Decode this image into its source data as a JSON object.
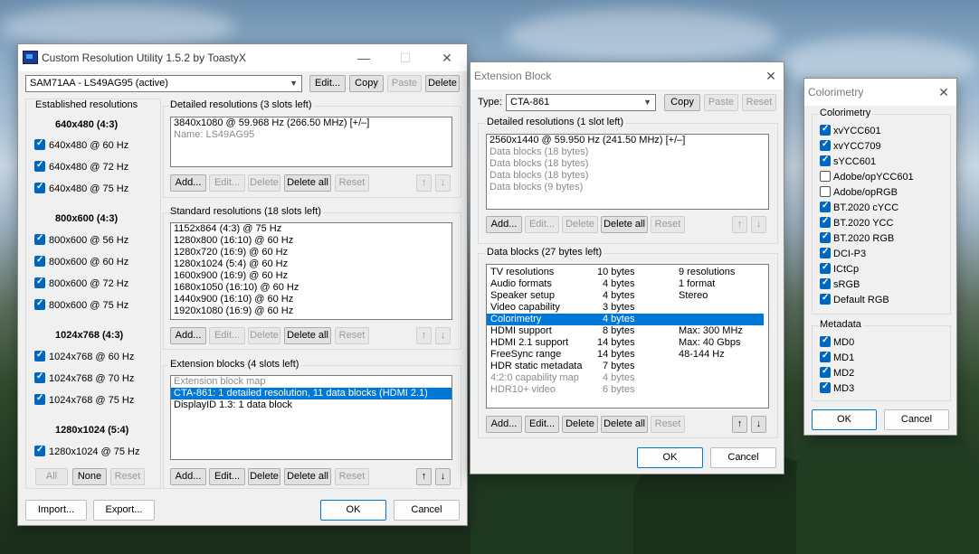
{
  "cru": {
    "title": "Custom Resolution Utility 1.5.2 by ToastyX",
    "monitor": "SAM71AA - LS49AG95 (active)",
    "top_buttons": {
      "edit": "Edit...",
      "copy": "Copy",
      "paste": "Paste",
      "delete": "Delete"
    },
    "established": {
      "title": "Established resolutions",
      "groups": [
        {
          "header": "640x480 (4:3)",
          "items": [
            "640x480 @ 60 Hz",
            "640x480 @ 72 Hz",
            "640x480 @ 75 Hz"
          ]
        },
        {
          "header": "800x600 (4:3)",
          "items": [
            "800x600 @ 56 Hz",
            "800x600 @ 60 Hz",
            "800x600 @ 72 Hz",
            "800x600 @ 75 Hz"
          ]
        },
        {
          "header": "1024x768 (4:3)",
          "items": [
            "1024x768 @ 60 Hz",
            "1024x768 @ 70 Hz",
            "1024x768 @ 75 Hz"
          ]
        },
        {
          "header": "1280x1024 (5:4)",
          "items": [
            "1280x1024 @ 75 Hz"
          ]
        }
      ],
      "all": "All",
      "none": "None",
      "reset": "Reset"
    },
    "detailed": {
      "title": "Detailed resolutions (3 slots left)",
      "items": [
        "3840x1080 @ 59.968 Hz (266.50 MHz) [+/–]",
        "Name: LS49AG95"
      ]
    },
    "standard": {
      "title": "Standard resolutions (18 slots left)",
      "items": [
        "1152x864 (4:3) @ 75 Hz",
        "1280x800 (16:10) @ 60 Hz",
        "1280x720 (16:9) @ 60 Hz",
        "1280x1024 (5:4) @ 60 Hz",
        "1600x900 (16:9) @ 60 Hz",
        "1680x1050 (16:10) @ 60 Hz",
        "1440x900 (16:10) @ 60 Hz",
        "1920x1080 (16:9) @ 60 Hz"
      ]
    },
    "extension": {
      "title": "Extension blocks (4 slots left)",
      "items": [
        "Extension block map",
        "CTA-861: 1 detailed resolution, 11 data blocks (HDMI 2.1)",
        "DisplayID 1.3: 1 data block"
      ]
    },
    "list_buttons": {
      "add": "Add...",
      "edit": "Edit...",
      "delete": "Delete",
      "delete_all": "Delete all",
      "reset": "Reset"
    },
    "bottom": {
      "import": "Import...",
      "export": "Export...",
      "ok": "OK",
      "cancel": "Cancel"
    }
  },
  "ext": {
    "title": "Extension Block",
    "type_label": "Type:",
    "type_value": "CTA-861",
    "copy": "Copy",
    "paste": "Paste",
    "reset": "Reset",
    "detailed": {
      "title": "Detailed resolutions (1 slot left)",
      "items": [
        "2560x1440 @ 59.950 Hz (241.50 MHz) [+/–]",
        "Data blocks (18 bytes)",
        "Data blocks (18 bytes)",
        "Data blocks (18 bytes)",
        "Data blocks (9 bytes)"
      ]
    },
    "data": {
      "title": "Data blocks (27 bytes left)",
      "rows": [
        [
          "TV resolutions",
          "10 bytes",
          "9 resolutions"
        ],
        [
          "Audio formats",
          "4 bytes",
          "1 format"
        ],
        [
          "Speaker setup",
          "4 bytes",
          "Stereo"
        ],
        [
          "Video capability",
          "3 bytes",
          ""
        ],
        [
          "Colorimetry",
          "4 bytes",
          ""
        ],
        [
          "HDMI support",
          "8 bytes",
          "Max: 300 MHz"
        ],
        [
          "HDMI 2.1 support",
          "14 bytes",
          "Max: 40 Gbps"
        ],
        [
          "FreeSync range",
          "14 bytes",
          "48-144 Hz"
        ],
        [
          "HDR static metadata",
          "7 bytes",
          ""
        ],
        [
          "4:2:0 capability map",
          "4 bytes",
          ""
        ],
        [
          "HDR10+ video",
          "6 bytes",
          ""
        ]
      ]
    },
    "ok": "OK",
    "cancel": "Cancel"
  },
  "color": {
    "title": "Colorimetry",
    "group1": "Colorimetry",
    "items": [
      {
        "label": "xvYCC601",
        "checked": true
      },
      {
        "label": "xvYCC709",
        "checked": true
      },
      {
        "label": "sYCC601",
        "checked": true
      },
      {
        "label": "Adobe/opYCC601",
        "checked": false
      },
      {
        "label": "Adobe/opRGB",
        "checked": false
      },
      {
        "label": "BT.2020 cYCC",
        "checked": true
      },
      {
        "label": "BT.2020 YCC",
        "checked": true
      },
      {
        "label": "BT.2020 RGB",
        "checked": true
      },
      {
        "label": "DCI-P3",
        "checked": true
      },
      {
        "label": "ICtCp",
        "checked": true
      },
      {
        "label": "sRGB",
        "checked": true
      },
      {
        "label": "Default RGB",
        "checked": true
      }
    ],
    "group2": "Metadata",
    "meta": [
      {
        "label": "MD0",
        "checked": true
      },
      {
        "label": "MD1",
        "checked": true
      },
      {
        "label": "MD2",
        "checked": true
      },
      {
        "label": "MD3",
        "checked": true
      }
    ],
    "ok": "OK",
    "cancel": "Cancel"
  },
  "icons": {
    "minimize": "—",
    "maximize": "☐",
    "close": "✕",
    "up": "↑",
    "down": "↓",
    "dropdown": "⌵"
  }
}
